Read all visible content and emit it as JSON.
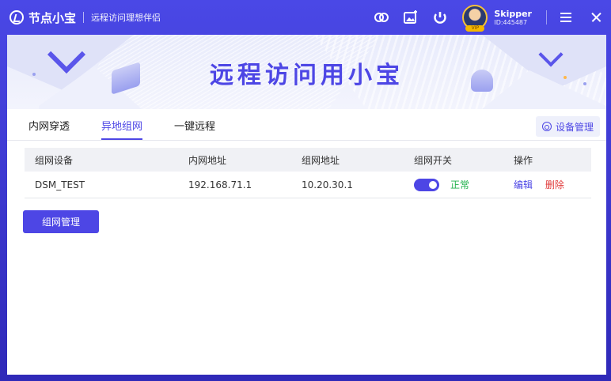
{
  "app": {
    "name": "节点小宝",
    "slogan": "远程访问理想伴侣"
  },
  "user": {
    "name": "Skipper",
    "id": "ID:445487",
    "badge": "VIP"
  },
  "banner": {
    "title": "远程访问用小宝"
  },
  "tabs": [
    {
      "label": "内网穿透",
      "active": false
    },
    {
      "label": "异地组网",
      "active": true
    },
    {
      "label": "一键远程",
      "active": false
    }
  ],
  "device_manage_label": "设备管理",
  "table": {
    "headers": [
      "组网设备",
      "内网地址",
      "组网地址",
      "组网开关",
      "操作"
    ],
    "rows": [
      {
        "device": "DSM_TEST",
        "lan_ip": "192.168.71.1",
        "vnet_ip": "10.20.30.1",
        "switch_on": true,
        "status": "正常",
        "edit": "编辑",
        "delete": "删除"
      }
    ]
  },
  "net_manage_button": "组网管理",
  "colors": {
    "accent": "#4d46e5",
    "status_ok": "#22b14c",
    "danger": "#e03b3b"
  },
  "icons": [
    "logo-icon",
    "link-icon",
    "image-icon",
    "power-icon",
    "menu-icon",
    "close-icon",
    "settings-icon"
  ]
}
